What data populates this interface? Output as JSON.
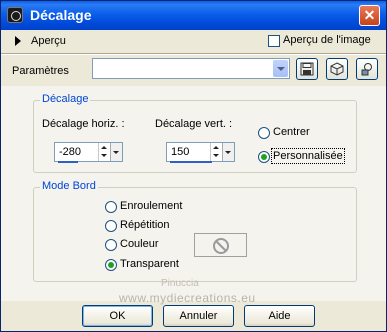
{
  "window": {
    "title": "Décalage",
    "close_label": "✕"
  },
  "preview": {
    "label": "Aperçu",
    "image_label": "Aperçu de l'image",
    "image_checked": false
  },
  "params": {
    "label": "Paramètres",
    "preset_value": ""
  },
  "offset": {
    "group_label": "Décalage",
    "horiz_label": "Décalage horiz. :",
    "horiz_value": "-280",
    "vert_label": "Décalage vert. :",
    "vert_value": "150",
    "options": [
      {
        "label": "Centrer",
        "selected": false
      },
      {
        "label": "Personnalisée",
        "selected": true
      }
    ]
  },
  "mode": {
    "group_label": "Mode Bord",
    "options": [
      {
        "label": "Enroulement",
        "selected": false
      },
      {
        "label": "Répétition",
        "selected": false
      },
      {
        "label": "Couleur",
        "selected": false
      },
      {
        "label": "Transparent",
        "selected": true
      }
    ]
  },
  "watermark": {
    "line1": "Pinuccia",
    "line2": "www.mydiecreations.eu"
  },
  "buttons": {
    "ok": "OK",
    "cancel": "Annuler",
    "help": "Aide"
  },
  "icons": {
    "preview": "triangle-right-icon",
    "save": "save-preset-icon",
    "reset": "reset-icon",
    "manage": "manage-presets-icon",
    "no_color": "no-color-icon"
  }
}
